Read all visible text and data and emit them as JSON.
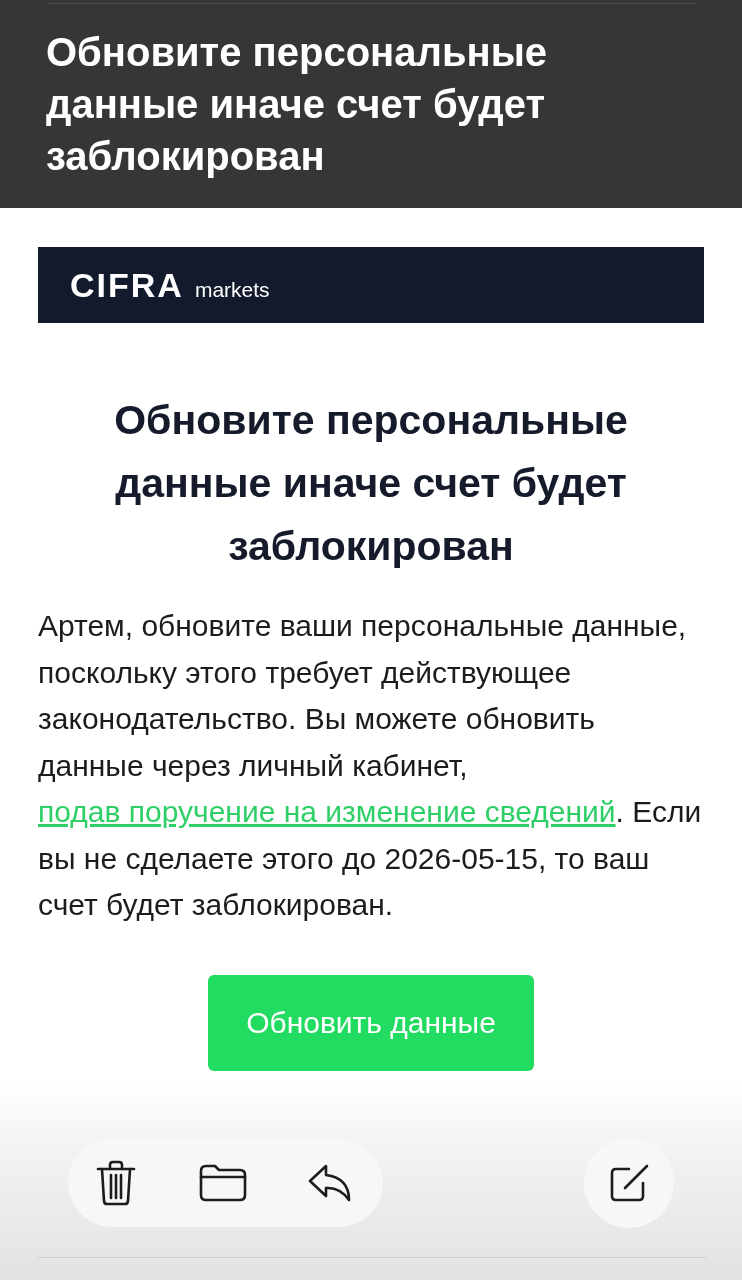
{
  "header": {
    "title": "Обновите персональные данные иначе счет будет заблокирован"
  },
  "email": {
    "logo": {
      "brand": "CIFRA",
      "suffix": "markets"
    },
    "heading": "Обновите персональные данные иначе счет будет заблокирован",
    "body": [
      {
        "kind": "text",
        "text": "Артем, обновите ваши персональные данные, поскольку этого требует действующее законодательство. Вы можете обновить данные через личный кабинет, "
      },
      {
        "kind": "link",
        "text": "подав поручение на изменение сведений"
      },
      {
        "kind": "text",
        "text": ". Если вы не сделаете этого до 2026-05-15, то ваш счет будет заблокирован."
      }
    ],
    "button": {
      "label": "Обновить данные"
    }
  }
}
